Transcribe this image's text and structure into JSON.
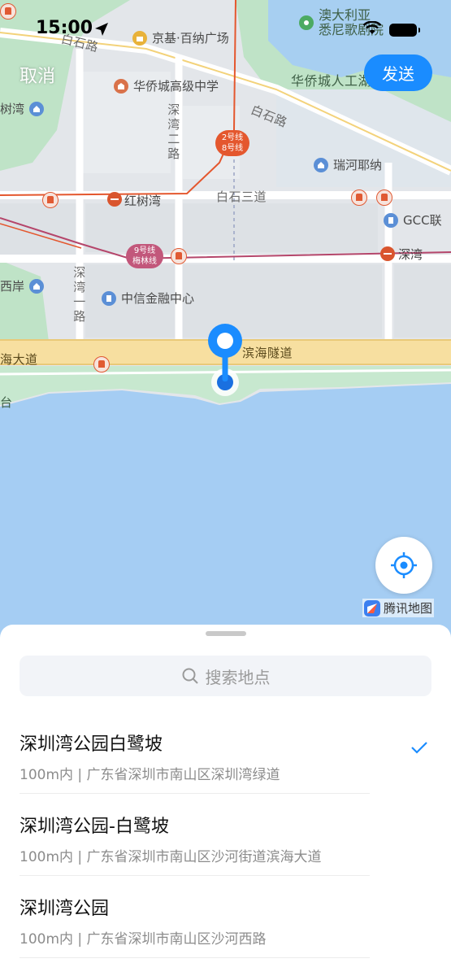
{
  "status": {
    "time": "15:00"
  },
  "header": {
    "cancel_label": "取消",
    "send_label": "发送"
  },
  "map": {
    "labels": {
      "baishilu_top": "白石路",
      "jingji_plaza": "京基·百纳广场",
      "australia_line1": "澳大利亚",
      "australia_line2": "悉尼歌剧院",
      "huaqiao_school": "华侨城高级中学",
      "huaqiao_lake": "华侨城人工湖",
      "baishilu_right": "白石路",
      "shuwan_left": "树湾",
      "shenwan_2": "深湾二路",
      "metro_2_8_line1": "2号线",
      "metro_2_8_line2": "8号线",
      "ruihe": "瑞河耶纳",
      "hongshuwan": "红树湾",
      "baishi_3": "白石三道",
      "gcc": "GCC联",
      "metro_9_line1": "9号线",
      "metro_9_line2": "梅林线",
      "shenwan_metro": "深湾",
      "xian_left": "西岸",
      "shenwan_1": "深湾一路",
      "citic": "中信金融中心",
      "binhai_tunnel": "滨海隧道",
      "haidadao": "海大道",
      "tai": "台"
    },
    "brand": "腾讯地图"
  },
  "sheet": {
    "search_placeholder": "搜索地点",
    "results": [
      {
        "name": "深圳湾公园白鹭坡",
        "address": "100m内 | 广东省深圳市南山区深圳湾绿道",
        "selected": true
      },
      {
        "name": "深圳湾公园-白鹭坡",
        "address": "100m内 | 广东省深圳市南山区沙河街道滨海大道",
        "selected": false
      },
      {
        "name": "深圳湾公园",
        "address": "100m内 | 广东省深圳市南山区沙河西路",
        "selected": false
      }
    ]
  },
  "colors": {
    "accent": "#1a8cff",
    "water": "#a5cdf3",
    "metro": "#e4572e",
    "line9": "#b5466b"
  }
}
